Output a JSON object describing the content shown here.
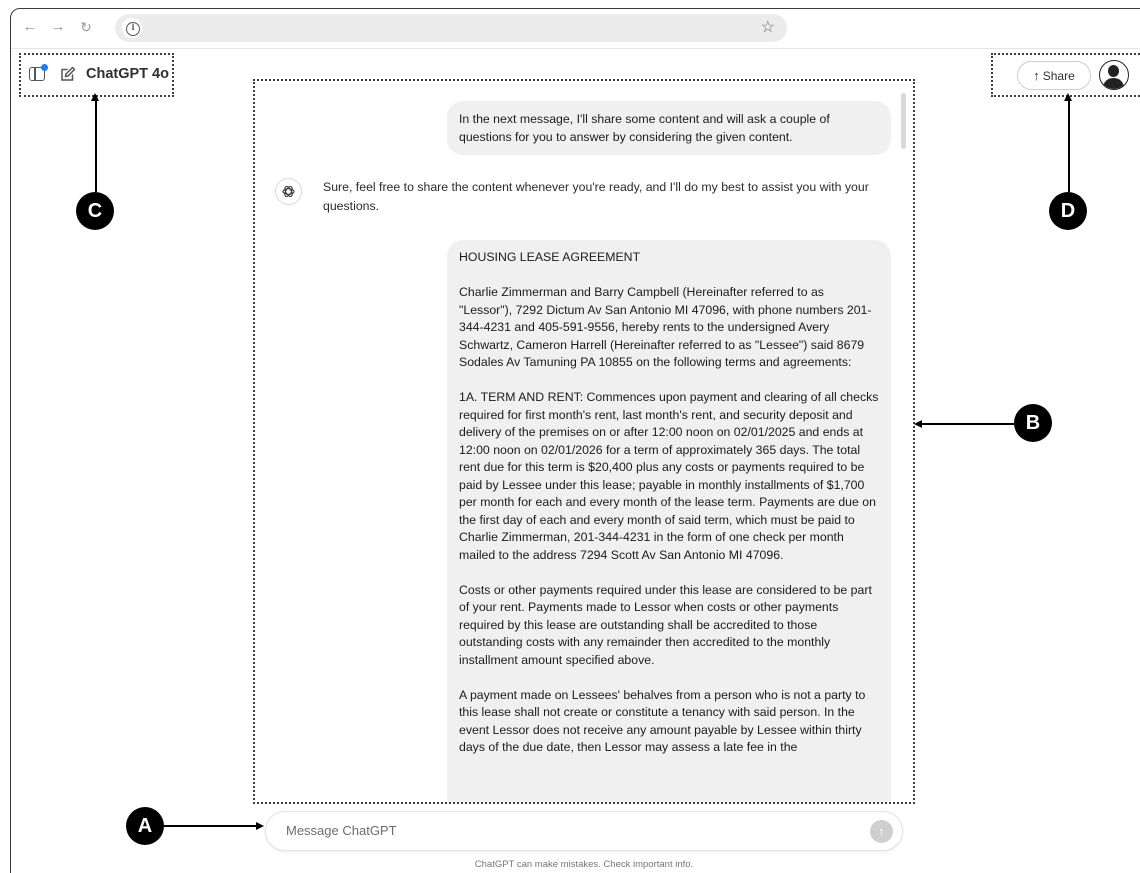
{
  "browser": {
    "back_icon": "arrow-left-icon",
    "forward_icon": "arrow-right-icon",
    "reload_icon": "reload-icon",
    "site_info_icon": "info-icon",
    "bookmark_icon": "star-icon"
  },
  "header": {
    "model_title": "ChatGPT 4o",
    "share_label": "Share",
    "sidebar_icon": "sidebar-toggle-icon",
    "new_chat_icon": "edit-icon",
    "avatar_icon": "user-avatar-icon",
    "notification_dot_color": "#1f7cf0"
  },
  "conversation": {
    "user_message_1": "In the next message, I'll share some content and will ask a couple of questions for you to answer by considering the given content.",
    "assistant_message_1": "Sure, feel free to share the content whenever you're ready, and I'll do my best to assist you with your questions.",
    "user_message_2": {
      "title": "HOUSING LEASE AGREEMENT",
      "paragraphs": [
        "Charlie Zimmerman and Barry Campbell (Hereinafter referred to as \"Lessor\"), 7292 Dictum Av San Antonio MI 47096, with phone numbers 201-344-4231 and 405-591-9556, hereby rents to the undersigned Avery Schwartz, Cameron Harrell (Hereinafter referred to as \"Lessee\") said 8679 Sodales Av Tamuning PA 10855 on the following terms and agreements:",
        "1A. TERM AND RENT: Commences upon payment and clearing of all checks required for first month's rent, last month's rent, and security deposit and delivery of the premises on or after 12:00 noon on 02/01/2025 and ends at 12:00 noon on 02/01/2026 for a term of approximately 365 days. The total rent due for this term is $20,400 plus any costs or payments required to be paid by Lessee under this lease; payable in monthly installments of $1,700 per month for each and every month of the lease term. Payments are due on the first day of each and every month of said term, which must be paid to Charlie Zimmerman, 201-344-4231 in the form of one check per month mailed to the address 7294 Scott Av San Antonio MI 47096.",
        "Costs or other payments required under this lease are considered to be part of your rent. Payments made to Lessor when costs or other payments required by this lease are outstanding shall be accredited to those outstanding costs with any remainder then accredited to the monthly installment amount specified above.",
        "A payment made on Lessees' behalves from a person who is not a party to this lease shall not create or constitute a tenancy with said person. In the event Lessor does not receive any amount payable by Lessee within thirty days of the due date, then Lessor may assess a late fee in the"
      ]
    },
    "assistant_icon": "openai-logo-icon"
  },
  "composer": {
    "placeholder": "Message ChatGPT",
    "send_icon": "arrow-up-icon",
    "disclaimer": "ChatGPT can make mistakes. Check important info."
  },
  "annotations": {
    "a": "A",
    "b": "B",
    "c": "C",
    "d": "D"
  }
}
